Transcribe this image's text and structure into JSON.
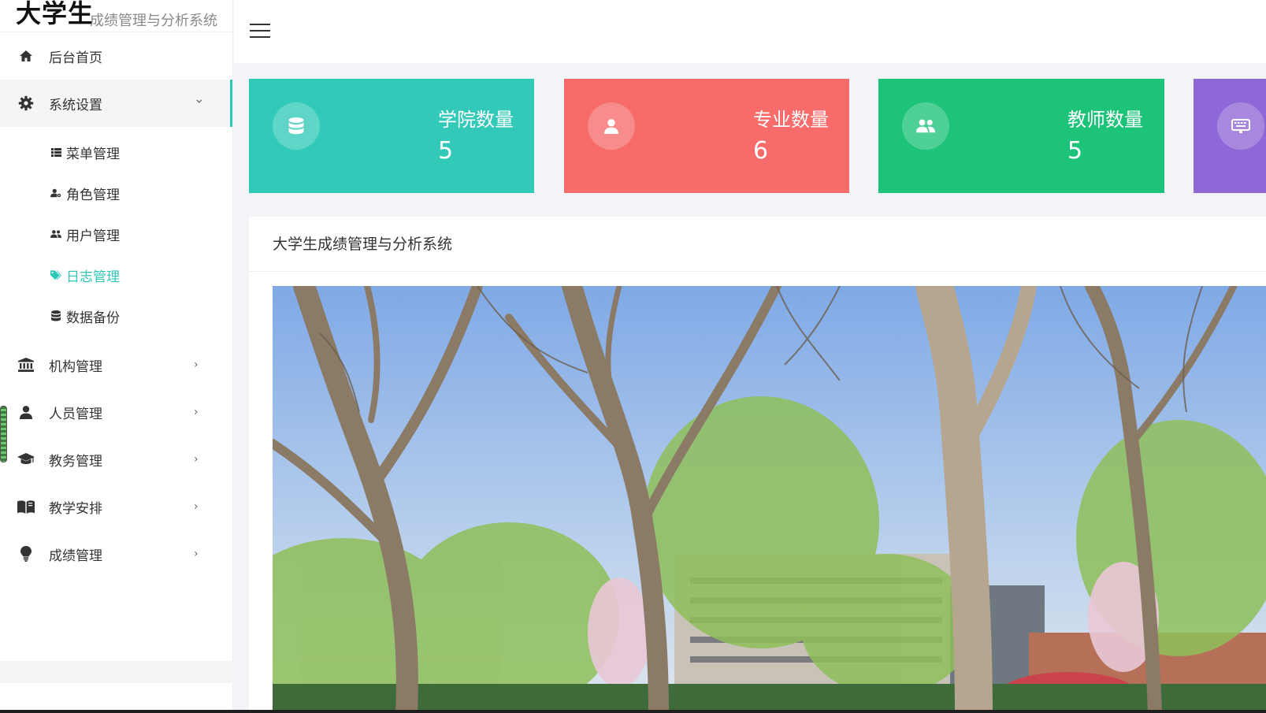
{
  "logo": {
    "main": "大学生",
    "sub": "成绩管理与分析系统"
  },
  "sidebar": {
    "items": [
      {
        "label": "后台首页",
        "icon": "home-icon"
      },
      {
        "label": "系统设置",
        "icon": "gear-icon",
        "arrow": "⌄",
        "open": true,
        "children": [
          {
            "label": "菜单管理",
            "icon": "list-icon"
          },
          {
            "label": "角色管理",
            "icon": "user-cog-icon"
          },
          {
            "label": "用户管理",
            "icon": "users-icon"
          },
          {
            "label": "日志管理",
            "icon": "tag-icon",
            "active": true
          },
          {
            "label": "数据备份",
            "icon": "database-icon"
          }
        ]
      },
      {
        "label": "机构管理",
        "icon": "institution-icon",
        "arrow": "›"
      },
      {
        "label": "人员管理",
        "icon": "user-icon",
        "arrow": "›"
      },
      {
        "label": "教务管理",
        "icon": "graduation-cap-icon",
        "arrow": "›"
      },
      {
        "label": "教学安排",
        "icon": "book-icon",
        "arrow": "›"
      },
      {
        "label": "成绩管理",
        "icon": "lightbulb-icon",
        "arrow": "›"
      }
    ]
  },
  "cards": [
    {
      "label": "学院数量",
      "value": "5",
      "color": "#33c9b9",
      "icon": "database-icon"
    },
    {
      "label": "专业数量",
      "value": "6",
      "color": "#f76b6b",
      "icon": "user-icon"
    },
    {
      "label": "教师数量",
      "value": "5",
      "color": "#1ec37a",
      "icon": "users-icon"
    },
    {
      "label": "",
      "value": "",
      "color": "#9067d6",
      "icon": "keyboard-icon"
    }
  ],
  "panel": {
    "title": "大学生成绩管理与分析系统"
  },
  "colors": {
    "accent": "#2ec7b8"
  }
}
